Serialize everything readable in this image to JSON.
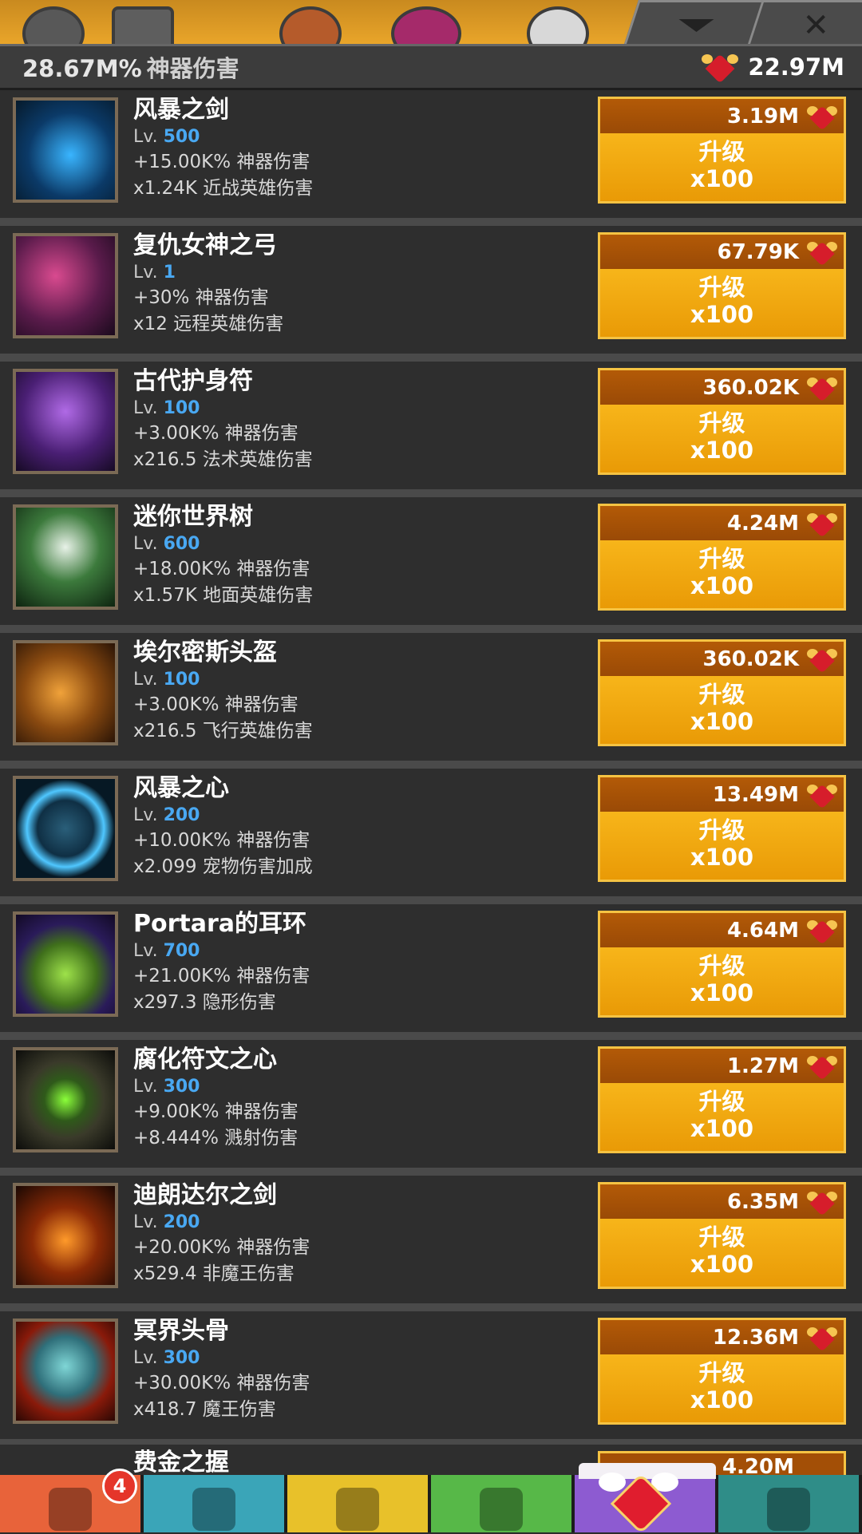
{
  "header": {
    "artifact_damage": "28.67M%",
    "artifact_damage_label": "神器伤害",
    "hearts_total": "22.97M"
  },
  "top_tabs": {
    "collapse_icon": "chevron-down-icon",
    "close_icon": "close-icon",
    "close_symbol": "✕"
  },
  "artifacts": [
    {
      "name": "风暴之剑",
      "lv_label": "Lv.",
      "level": "500",
      "line1": "+15.00K% 神器伤害",
      "line2": "x1.24K 近战英雄伤害",
      "cost": "3.19M",
      "button_title": "升级",
      "button_qty": "x100",
      "icon": "storm-sword-icon"
    },
    {
      "name": "复仇女神之弓",
      "lv_label": "Lv.",
      "level": "1",
      "line1": "+30% 神器伤害",
      "line2": "x12 远程英雄伤害",
      "cost": "67.79K",
      "button_title": "升级",
      "button_qty": "x100",
      "icon": "nemesis-bow-icon"
    },
    {
      "name": "古代护身符",
      "lv_label": "Lv.",
      "level": "100",
      "line1": "+3.00K% 神器伤害",
      "line2": "x216.5 法术英雄伤害",
      "cost": "360.02K",
      "button_title": "升级",
      "button_qty": "x100",
      "icon": "ancient-amulet-icon"
    },
    {
      "name": "迷你世界树",
      "lv_label": "Lv.",
      "level": "600",
      "line1": "+18.00K% 神器伤害",
      "line2": "x1.57K 地面英雄伤害",
      "cost": "4.24M",
      "button_title": "升级",
      "button_qty": "x100",
      "icon": "mini-world-tree-icon"
    },
    {
      "name": "埃尔密斯头盔",
      "lv_label": "Lv.",
      "level": "100",
      "line1": "+3.00K% 神器伤害",
      "line2": "x216.5 飞行英雄伤害",
      "cost": "360.02K",
      "button_title": "升级",
      "button_qty": "x100",
      "icon": "hermes-helmet-icon"
    },
    {
      "name": "风暴之心",
      "lv_label": "Lv.",
      "level": "200",
      "line1": "+10.00K% 神器伤害",
      "line2": "x2.099 宠物伤害加成",
      "cost": "13.49M",
      "button_title": "升级",
      "button_qty": "x100",
      "icon": "storm-heart-icon"
    },
    {
      "name": "Portara的耳环",
      "lv_label": "Lv.",
      "level": "700",
      "line1": "+21.00K% 神器伤害",
      "line2": "x297.3 隐形伤害",
      "cost": "4.64M",
      "button_title": "升级",
      "button_qty": "x100",
      "icon": "portara-earring-icon"
    },
    {
      "name": "腐化符文之心",
      "lv_label": "Lv.",
      "level": "300",
      "line1": "+9.00K% 神器伤害",
      "line2": "+8.444% 溅射伤害",
      "cost": "1.27M",
      "button_title": "升级",
      "button_qty": "x100",
      "icon": "corrupted-rune-heart-icon"
    },
    {
      "name": "迪朗达尔之剑",
      "lv_label": "Lv.",
      "level": "200",
      "line1": "+20.00K% 神器伤害",
      "line2": "x529.4 非魔王伤害",
      "cost": "6.35M",
      "button_title": "升级",
      "button_qty": "x100",
      "icon": "durendal-sword-icon"
    },
    {
      "name": "冥界头骨",
      "lv_label": "Lv.",
      "level": "300",
      "line1": "+30.00K% 神器伤害",
      "line2": "x418.7 魔王伤害",
      "cost": "12.36M",
      "button_title": "升级",
      "button_qty": "x100",
      "icon": "underworld-skull-icon"
    }
  ],
  "peek_row": {
    "name": "费金之握",
    "cost": "4.20M"
  },
  "bottom_tabs": [
    {
      "icon": "sword-icon",
      "badge": "4"
    },
    {
      "icon": "viking-helmet-icon"
    },
    {
      "icon": "shirt-icon"
    },
    {
      "icon": "pet-icon"
    },
    {
      "icon": "winged-heart-icon"
    },
    {
      "icon": "chest-icon"
    }
  ],
  "colors": {
    "level_blue": "#49a8f2",
    "button_orange": "#f0a40f",
    "button_border": "#f5c343",
    "cost_bar": "#a34f06"
  }
}
